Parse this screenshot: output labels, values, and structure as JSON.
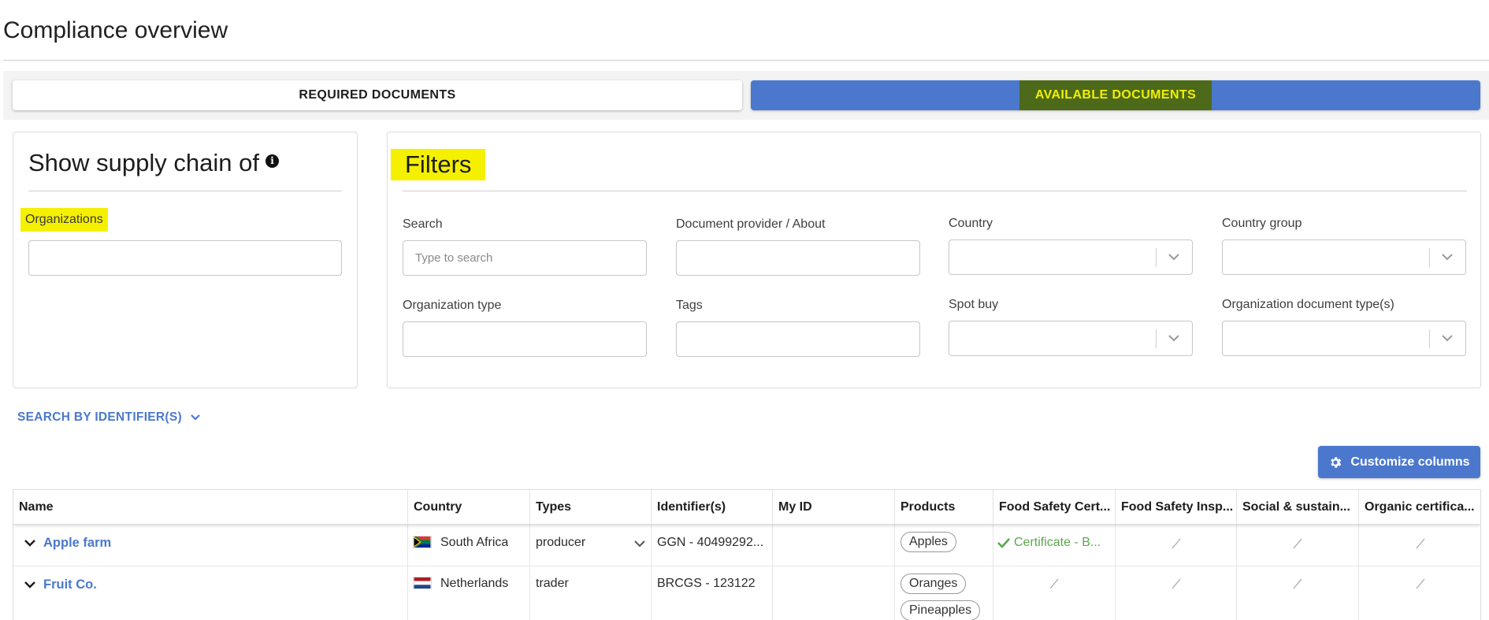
{
  "page": {
    "title": "Compliance overview"
  },
  "tabs": [
    {
      "label": "REQUIRED DOCUMENTS",
      "active": false
    },
    {
      "label": "AVAILABLE DOCUMENTS",
      "active": true
    }
  ],
  "supply_chain": {
    "heading": "Show supply chain of",
    "info_icon": "info-icon",
    "organizations_label": "Organizations",
    "organizations_value": ""
  },
  "filters": {
    "heading": "Filters",
    "search": {
      "label": "Search",
      "placeholder": "Type to search",
      "value": ""
    },
    "document_provider": {
      "label": "Document provider / About",
      "value": ""
    },
    "country": {
      "label": "Country",
      "value": ""
    },
    "country_group": {
      "label": "Country group",
      "value": ""
    },
    "organization_type": {
      "label": "Organization type",
      "value": ""
    },
    "tags": {
      "label": "Tags",
      "value": ""
    },
    "spot_buy": {
      "label": "Spot buy",
      "value": ""
    },
    "org_doc_types": {
      "label": "Organization document type(s)",
      "value": ""
    }
  },
  "search_by_identifier": {
    "label": "SEARCH BY IDENTIFIER(S)",
    "icon": "chevron-down-icon"
  },
  "customize_columns": {
    "label": "Customize columns",
    "icon": "gear-icon"
  },
  "colors": {
    "accent": "#4b78cd",
    "highlight": "#f5f000",
    "success": "#5aa84c"
  },
  "table": {
    "columns": [
      "Name",
      "Country",
      "Types",
      "Identifier(s)",
      "My ID",
      "Products",
      "Food Safety Cert...",
      "Food Safety Insp...",
      "Social & sustain...",
      "Organic certifica..."
    ],
    "rows": [
      {
        "name": "Apple farm",
        "country": "South Africa",
        "flag": "south-africa-flag",
        "types": "producer",
        "identifiers": "GGN - 40499292...",
        "my_id": "",
        "products": [
          "Apples"
        ],
        "food_safety_cert": "Certificate - B...",
        "food_safety_insp": "/",
        "social": "/",
        "organic": "/"
      },
      {
        "name": "Fruit Co.",
        "country": "Netherlands",
        "flag": "netherlands-flag",
        "types": "trader",
        "identifiers": "BRCGS - 123122",
        "my_id": "",
        "products": [
          "Oranges",
          "Pineapples"
        ],
        "food_safety_cert": "/",
        "food_safety_insp": "/",
        "social": "/",
        "organic": "/"
      }
    ]
  }
}
